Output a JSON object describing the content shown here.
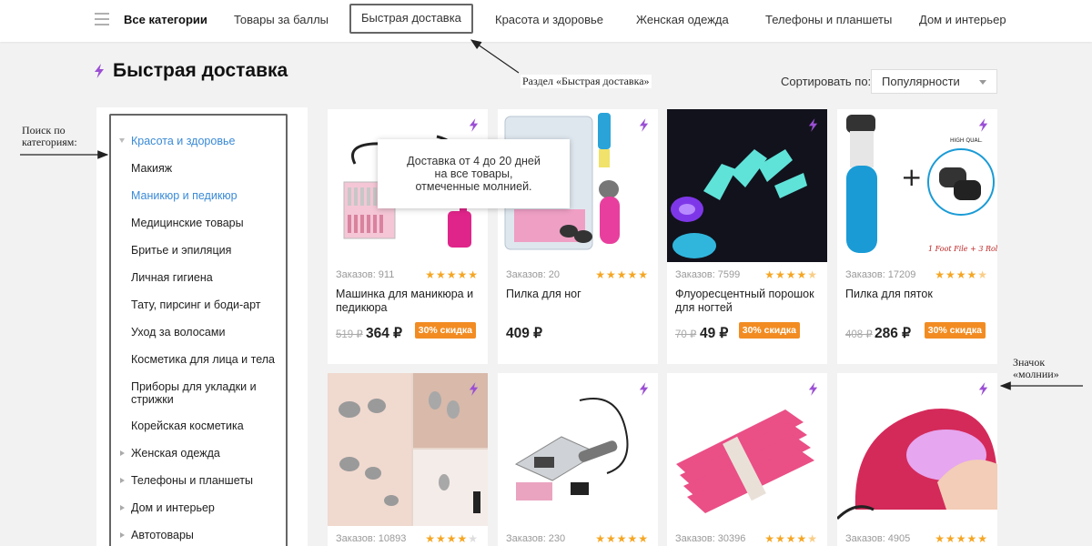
{
  "nav": {
    "items": [
      {
        "label": "Все категории"
      },
      {
        "label": "Товары за баллы"
      },
      {
        "label": "Быстрая доставка"
      },
      {
        "label": "Красота и здоровье"
      },
      {
        "label": "Женская одежда"
      },
      {
        "label": "Телефоны и планшеты"
      },
      {
        "label": "Дом и интерьер"
      }
    ]
  },
  "page": {
    "title": "Быстрая доставка",
    "sort_label": "Сортировать по:",
    "sort_value": "Популярности"
  },
  "sidebar": {
    "items": [
      {
        "label": "Красота и здоровье",
        "expanded": true,
        "active": true
      },
      {
        "label": "Макияж"
      },
      {
        "label": "Маникюр и педикюр",
        "active": true
      },
      {
        "label": "Медицинские товары"
      },
      {
        "label": "Бритье и эпиляция"
      },
      {
        "label": "Личная гигиена"
      },
      {
        "label": "Тату, пирсинг и боди-арт"
      },
      {
        "label": "Уход за волосами"
      },
      {
        "label": "Косметика для лица и тела"
      },
      {
        "label": "Приборы для укладки и стрижки"
      },
      {
        "label": "Корейская косметика"
      },
      {
        "label": "Женская одежда",
        "collapsed": true
      },
      {
        "label": "Телефоны и планшеты",
        "collapsed": true
      },
      {
        "label": "Дом и интерьер",
        "collapsed": true
      },
      {
        "label": "Автотовары",
        "collapsed": true
      }
    ]
  },
  "tooltip": {
    "line1": "Доставка от 4 до 20 дней",
    "line2": "на все товары,",
    "line3": "отмеченные молнией."
  },
  "products": [
    {
      "orders": "Заказов: 911",
      "rating": 5,
      "name": "Машинка для маникюра и педикюра",
      "old_price": "519 ₽",
      "price": "364 ₽",
      "discount": "30% скидка"
    },
    {
      "orders": "Заказов: 20",
      "rating": 5,
      "name": "Пилка для ног",
      "old_price": "",
      "price": "409 ₽",
      "discount": ""
    },
    {
      "orders": "Заказов: 7599",
      "rating": 4.5,
      "name": "Флуоресцентный порошок для ногтей",
      "old_price": "70 ₽",
      "price": "49 ₽",
      "discount": "30% скидка"
    },
    {
      "orders": "Заказов: 17209",
      "rating": 4.5,
      "name": "Пилка для пяток",
      "old_price": "408 ₽",
      "price": "286 ₽",
      "discount": "30% скидка"
    },
    {
      "orders": "Заказов: 10893",
      "rating": 4
    },
    {
      "orders": "Заказов: 230",
      "rating": 5
    },
    {
      "orders": "Заказов: 30396",
      "rating": 4.5
    },
    {
      "orders": "Заказов: 4905",
      "rating": 5
    }
  ],
  "annotations": {
    "section": "Раздел «Быстрая доставка»",
    "search_line1": "Поиск по",
    "search_line2": "категориям:",
    "bolt_line1": "Значок",
    "bolt_line2": "«молнии»"
  },
  "colors": {
    "accent_blue": "#3a8ad6",
    "bolt_purple": "#9b4fd4",
    "discount_orange": "#f28c22",
    "star_orange": "#f5a623"
  }
}
